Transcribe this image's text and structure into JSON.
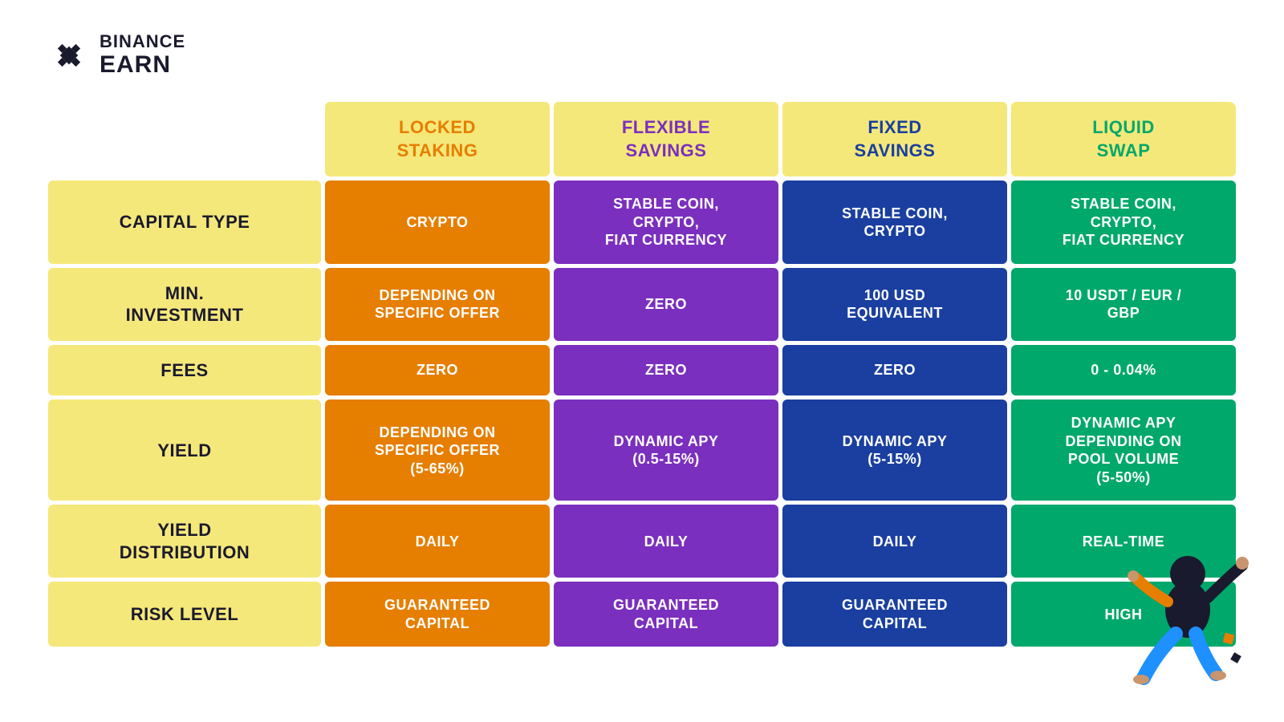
{
  "logo": {
    "binance": "✦ BINANCE",
    "earn": "EARN",
    "icon_label": "binance-logo"
  },
  "columns": [
    {
      "id": "locked",
      "label": "LOCKED\nSTAKING",
      "color": "locked-staking"
    },
    {
      "id": "flexible",
      "label": "FLEXIBLE\nSAVINGS",
      "color": "flexible-savings"
    },
    {
      "id": "fixed",
      "label": "FIXED\nSAVINGS",
      "color": "fixed-savings"
    },
    {
      "id": "liquid",
      "label": "LIQUID\nSWAP",
      "color": "liquid-swap"
    }
  ],
  "rows": [
    {
      "label": "CAPITAL TYPE",
      "cells": [
        {
          "text": "CRYPTO",
          "color": "orange"
        },
        {
          "text": "STABLE COIN,\nCRYPTO,\nFIAT CURRENCY",
          "color": "purple"
        },
        {
          "text": "STABLE COIN,\nCRYPTO",
          "color": "blue"
        },
        {
          "text": "STABLE COIN,\nCRYPTO,\nFIAT CURRENCY",
          "color": "green"
        }
      ]
    },
    {
      "label": "MIN.\nINVESTMENT",
      "cells": [
        {
          "text": "DEPENDING ON\nSPECIFIC OFFER",
          "color": "orange"
        },
        {
          "text": "ZERO",
          "color": "purple"
        },
        {
          "text": "100 USD\nEQUIVALENT",
          "color": "blue"
        },
        {
          "text": "10 USDT / EUR /\nGBP",
          "color": "green"
        }
      ]
    },
    {
      "label": "FEES",
      "cells": [
        {
          "text": "ZERO",
          "color": "orange"
        },
        {
          "text": "ZERO",
          "color": "purple"
        },
        {
          "text": "ZERO",
          "color": "blue"
        },
        {
          "text": "0 - 0.04%",
          "color": "green"
        }
      ]
    },
    {
      "label": "YIELD",
      "cells": [
        {
          "text": "DEPENDING ON\nSPECIFIC OFFER\n(5-65%)",
          "color": "orange"
        },
        {
          "text": "DYNAMIC APY\n(0.5-15%)",
          "color": "purple"
        },
        {
          "text": "DYNAMIC APY\n(5-15%)",
          "color": "blue"
        },
        {
          "text": "DYNAMIC APY\nDEPENDING ON\nPOOL VOLUME\n(5-50%)",
          "color": "green"
        }
      ]
    },
    {
      "label": "YIELD\nDISTRIBUTION",
      "cells": [
        {
          "text": "DAILY",
          "color": "orange"
        },
        {
          "text": "DAILY",
          "color": "purple"
        },
        {
          "text": "DAILY",
          "color": "blue"
        },
        {
          "text": "REAL-TIME",
          "color": "green"
        }
      ]
    },
    {
      "label": "RISK LEVEL",
      "cells": [
        {
          "text": "GUARANTEED\nCAPITAL",
          "color": "orange"
        },
        {
          "text": "GUARANTEED\nCAPITAL",
          "color": "purple"
        },
        {
          "text": "GUARANTEED\nCAPITAL",
          "color": "blue"
        },
        {
          "text": "HIGH",
          "color": "green"
        }
      ]
    }
  ]
}
